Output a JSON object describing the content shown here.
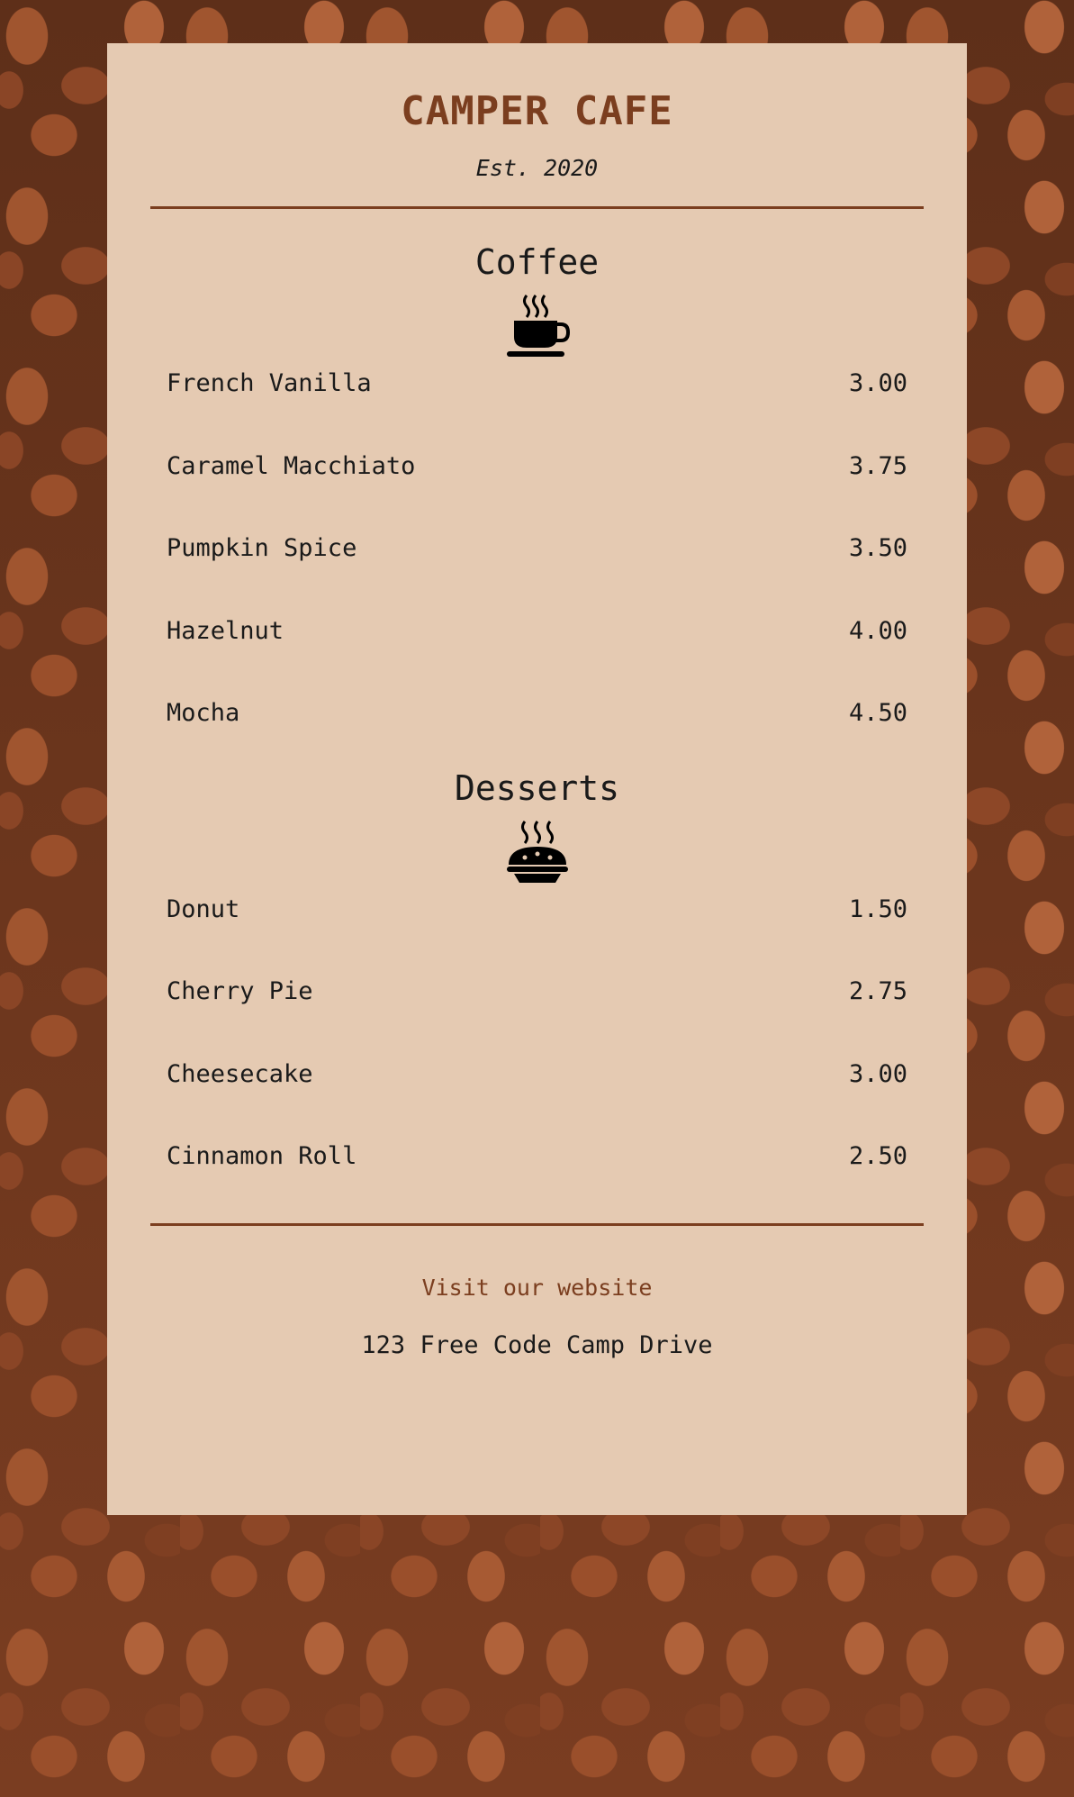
{
  "header": {
    "title": "CAMPER CAFE",
    "established": "Est. 2020"
  },
  "coffee": {
    "title": "Coffee",
    "icon": "coffee-cup-icon",
    "items": [
      {
        "name": "French Vanilla",
        "price": "3.00"
      },
      {
        "name": "Caramel Macchiato",
        "price": "3.75"
      },
      {
        "name": "Pumpkin Spice",
        "price": "3.50"
      },
      {
        "name": "Hazelnut",
        "price": "4.00"
      },
      {
        "name": "Mocha",
        "price": "4.50"
      }
    ]
  },
  "desserts": {
    "title": "Desserts",
    "icon": "pie-icon",
    "items": [
      {
        "name": "Donut",
        "price": "1.50"
      },
      {
        "name": "Cherry Pie",
        "price": "2.75"
      },
      {
        "name": "Cheesecake",
        "price": "3.00"
      },
      {
        "name": "Cinnamon Roll",
        "price": "2.50"
      }
    ]
  },
  "footer": {
    "website_link": "Visit our website",
    "address": "123 Free Code Camp Drive"
  },
  "colors": {
    "accent": "#7b3e1f",
    "menu_background": "#e5cab2",
    "text": "#1a1a1a"
  }
}
